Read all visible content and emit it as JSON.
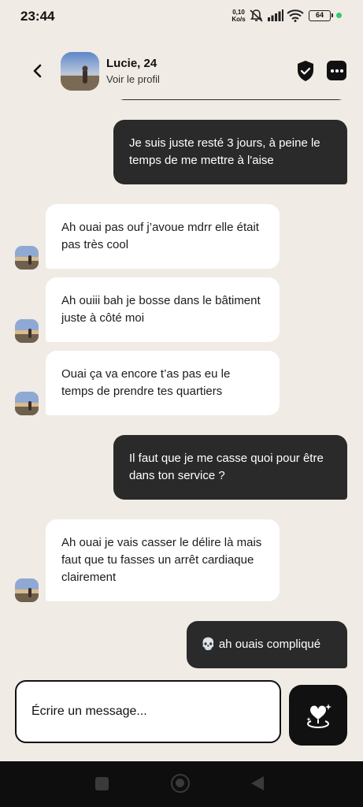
{
  "status_bar": {
    "time": "23:44",
    "speed_value": "0,10",
    "speed_unit": "Ko/s",
    "battery": "64"
  },
  "header": {
    "name": "Lucie, 24",
    "profile_link": "Voir le profil"
  },
  "messages": [
    {
      "sender": "me",
      "text": "Je suis juste resté 3 jours, à peine le temps de me mettre à l'aise"
    },
    {
      "sender": "them",
      "text": "Ah ouai pas ouf j’avoue mdrr elle était pas très cool"
    },
    {
      "sender": "them",
      "text": "Ah ouiii bah je bosse dans le bâtiment juste à côté moi"
    },
    {
      "sender": "them",
      "text": "Ouai ça va encore t’as pas eu le temps de prendre tes quartiers"
    },
    {
      "sender": "me",
      "text": "Il faut que je me casse quoi pour être dans ton service ?"
    },
    {
      "sender": "them",
      "text": "Ah ouai je vais casser le délire là mais faut que tu fasses un arrêt cardiaque clairement"
    },
    {
      "sender": "me",
      "text": "💀 ah ouais compliqué"
    }
  ],
  "composer": {
    "placeholder": "Écrire un message..."
  },
  "icons": {
    "back": "chevron-left-icon",
    "verified": "shield-check-icon",
    "more": "more-dots-icon",
    "send": "heart-sparkle-icon"
  },
  "colors": {
    "background": "#f0ebe4",
    "outgoing_bubble": "#2a2a2a",
    "incoming_bubble": "#ffffff",
    "status_dot": "#2ecc71"
  }
}
